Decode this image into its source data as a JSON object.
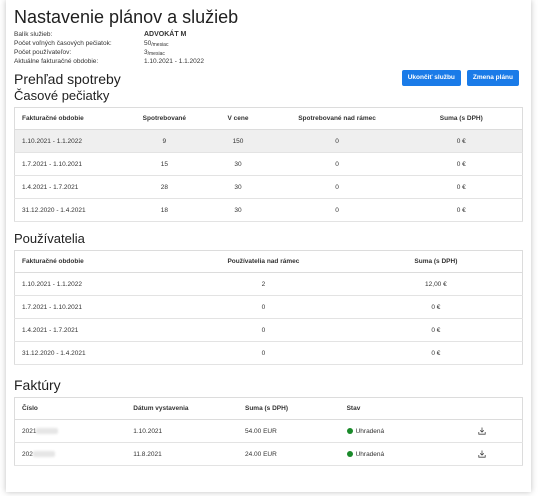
{
  "page_title": "Nastavenie plánov a služieb",
  "info": [
    {
      "label": "Balík služieb:",
      "value": "ADVOKÁT M",
      "bold": true
    },
    {
      "label": "Počet voľných časových pečiatok:",
      "value": "50",
      "sub": "/mesiac"
    },
    {
      "label": "Počet používateľov:",
      "value": "3",
      "sub": "/mesiac"
    },
    {
      "label": "Aktuálne fakturačné obdobie:",
      "value": "1.10.2021 - 1.1.2022"
    }
  ],
  "buttons": {
    "cancel": "Ukončiť službu",
    "change": "Zmena plánu"
  },
  "overview_title": "Prehľad spotreby",
  "stamps": {
    "title": "Časové pečiatky",
    "headers": [
      "Fakturačné obdobie",
      "Spotrebované",
      "V cene",
      "Spotrebované nad rámec",
      "Suma (s DPH)"
    ],
    "rows": [
      [
        "1.10.2021 - 1.1.2022",
        "9",
        "150",
        "0",
        "0 €"
      ],
      [
        "1.7.2021 - 1.10.2021",
        "15",
        "30",
        "0",
        "0 €"
      ],
      [
        "1.4.2021 - 1.7.2021",
        "28",
        "30",
        "0",
        "0 €"
      ],
      [
        "31.12.2020 - 1.4.2021",
        "18",
        "30",
        "0",
        "0 €"
      ]
    ]
  },
  "users": {
    "title": "Používatelia",
    "headers": [
      "Fakturačné obdobie",
      "Používatelia nad rámec",
      "Suma (s DPH)"
    ],
    "rows": [
      [
        "1.10.2021 - 1.1.2022",
        "2",
        "12,00 €"
      ],
      [
        "1.7.2021 - 1.10.2021",
        "0",
        "0 €"
      ],
      [
        "1.4.2021 - 1.7.2021",
        "0",
        "0 €"
      ],
      [
        "31.12.2020 - 1.4.2021",
        "0",
        "0 €"
      ]
    ]
  },
  "invoices": {
    "title": "Faktúry",
    "headers": [
      "Číslo",
      "Dátum vystavenia",
      "Suma (s DPH)",
      "Stav"
    ],
    "rows": [
      {
        "number": "2021",
        "date": "1.10.2021",
        "amount": "54.00 EUR",
        "status": "Uhradená"
      },
      {
        "number": "202",
        "date": "11.8.2021",
        "amount": "24.00 EUR",
        "status": "Uhradená"
      }
    ],
    "status_color": "#1a8a2a"
  },
  "accent_color": "#1a7be8"
}
